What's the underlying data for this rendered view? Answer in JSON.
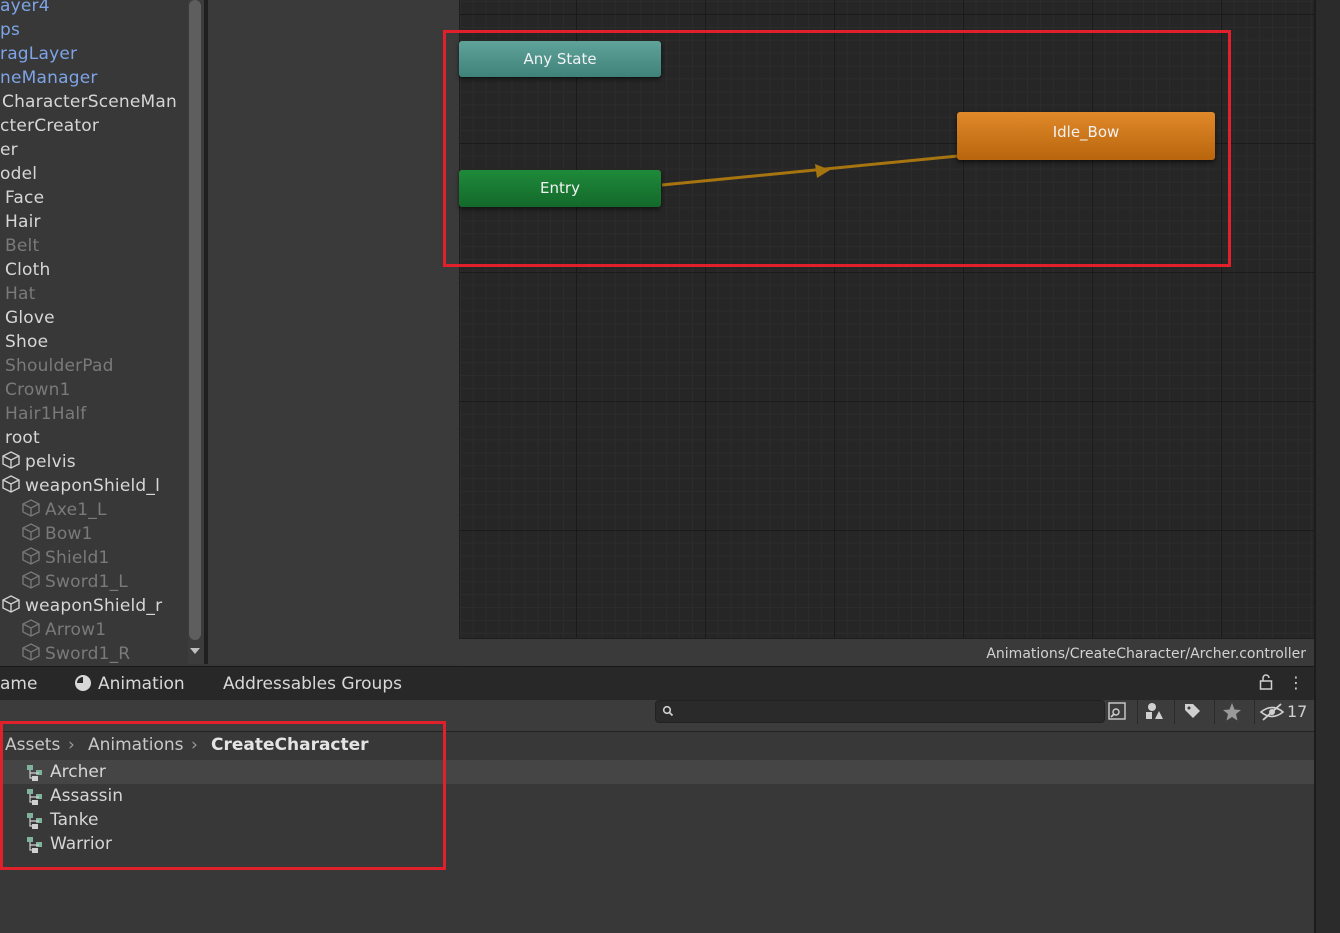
{
  "hierarchy": {
    "items": [
      {
        "label": "ayer4",
        "style": "blue"
      },
      {
        "label": "ps",
        "style": "blue"
      },
      {
        "label": "ragLayer",
        "style": "blue"
      },
      {
        "label": "neManager",
        "style": "blue"
      },
      {
        "label": "CharacterSceneMan",
        "style": "white"
      },
      {
        "label": "cterCreator",
        "style": "white"
      },
      {
        "label": "er",
        "style": "white"
      },
      {
        "label": "odel",
        "style": "white"
      },
      {
        "label": "Face",
        "style": "white"
      },
      {
        "label": "Hair",
        "style": "white"
      },
      {
        "label": "Belt",
        "style": "dim"
      },
      {
        "label": "Cloth",
        "style": "white"
      },
      {
        "label": "Hat",
        "style": "dim"
      },
      {
        "label": "Glove",
        "style": "white"
      },
      {
        "label": "Shoe",
        "style": "white"
      },
      {
        "label": "ShoulderPad",
        "style": "dim"
      },
      {
        "label": "Crown1",
        "style": "dim"
      },
      {
        "label": "Hair1Half",
        "style": "dim"
      },
      {
        "label": "root",
        "style": "white"
      },
      {
        "label": "pelvis",
        "style": "white",
        "icon": "cube-icon"
      },
      {
        "label": "weaponShield_l",
        "style": "white",
        "icon": "cube-icon"
      },
      {
        "label": "Axe1_L",
        "style": "dim",
        "icon": "cube-icon"
      },
      {
        "label": "Bow1",
        "style": "dim",
        "icon": "cube-icon"
      },
      {
        "label": "Shield1",
        "style": "dim",
        "icon": "cube-icon"
      },
      {
        "label": "Sword1_L",
        "style": "dim",
        "icon": "cube-icon"
      },
      {
        "label": "weaponShield_r",
        "style": "white",
        "icon": "cube-icon"
      },
      {
        "label": "Arrow1",
        "style": "dim",
        "icon": "cube-icon"
      },
      {
        "label": "Sword1_R",
        "style": "dim",
        "icon": "cube-icon"
      }
    ]
  },
  "animator": {
    "states": {
      "any_state": "Any State",
      "entry": "Entry",
      "idle_bow": "Idle_Bow"
    },
    "controller_path": "Animations/CreateCharacter/Archer.controller"
  },
  "bottom_tabs": {
    "game": "ame",
    "animation": "Animation",
    "addressables": "Addressables Groups"
  },
  "toolbar": {
    "search_value": "",
    "hidden_count": "17"
  },
  "breadcrumb": [
    "Assets",
    "Animations",
    "CreateCharacter"
  ],
  "files": [
    {
      "name": "Archer",
      "selected": true
    },
    {
      "name": "Assassin",
      "selected": false
    },
    {
      "name": "Tanke",
      "selected": false
    },
    {
      "name": "Warrior",
      "selected": false
    }
  ],
  "colors": {
    "any_state": "#4f9389",
    "entry": "#1a7d33",
    "idle_bow": "#d07a1c",
    "highlight_box": "#e0202a",
    "transition": "#b8860b"
  }
}
